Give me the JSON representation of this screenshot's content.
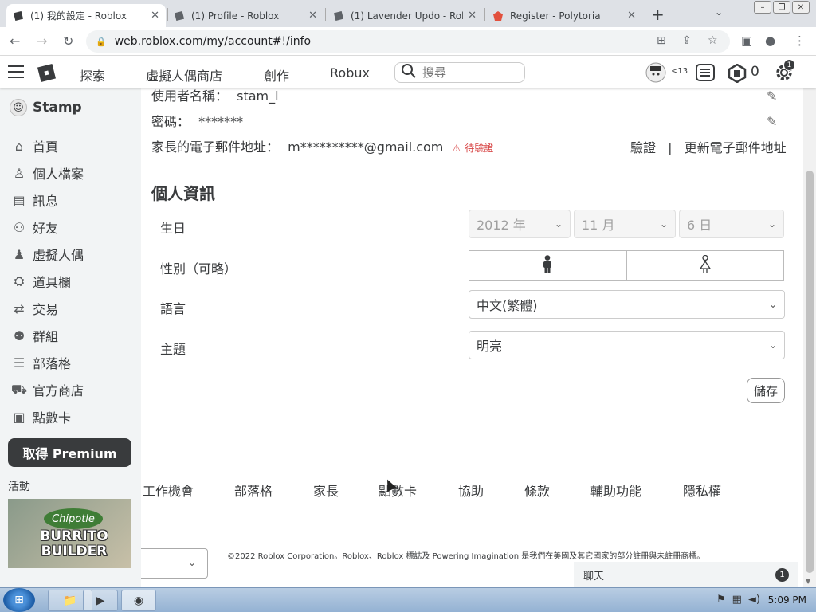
{
  "browser": {
    "tabs": [
      {
        "title": "(1) 我的設定 - Roblox",
        "active": true
      },
      {
        "title": "(1) Profile - Roblox",
        "active": false
      },
      {
        "title": "(1) Lavender Updo - Robl",
        "active": false
      },
      {
        "title": "Register - Polytoria",
        "active": false
      }
    ],
    "url": "web.roblox.com/my/account#!/info"
  },
  "topnav": {
    "items": [
      "探索",
      "虛擬人偶商店",
      "創作",
      "Robux"
    ],
    "search_placeholder": "搜尋",
    "age_label": "<13",
    "robux_count": "0",
    "notif_count": "1"
  },
  "sidebar": {
    "username": "Stamp",
    "items": [
      "首頁",
      "個人檔案",
      "訊息",
      "好友",
      "虛擬人偶",
      "道具欄",
      "交易",
      "群組",
      "部落格",
      "官方商店",
      "點數卡"
    ],
    "premium_label": "取得 Premium",
    "events_label": "活動",
    "event_badge": "Chipotle",
    "event_title": "BURRITO BUILDER"
  },
  "account": {
    "username_label": "使用者名稱：",
    "username_value": "stam_l",
    "password_label": "密碼：",
    "password_value": "*******",
    "email_label": "家長的電子郵件地址：",
    "email_value": "m**********@gmail.com",
    "email_status": "待驗證",
    "verify_link": "驗證",
    "separator": "|",
    "update_email_link": "更新電子郵件地址"
  },
  "personal": {
    "heading": "個人資訊",
    "birthday_label": "生日",
    "birthday_year": "2012 年",
    "birthday_month": "11 月",
    "birthday_day": "6 日",
    "gender_label": "性別（可略）",
    "language_label": "語言",
    "language_value": "中文(繁體)",
    "theme_label": "主題",
    "theme_value": "明亮",
    "save_label": "儲存"
  },
  "footer": {
    "links": [
      "工作機會",
      "部落格",
      "家長",
      "點數卡",
      "協助",
      "條款",
      "輔助功能",
      "隱私權"
    ],
    "copyright": "©2022 Roblox Corporation。Roblox、Roblox 標誌及 Powering Imagination 是我們在美國及其它國家的部分註冊與未註冊商標。"
  },
  "chat": {
    "label": "聊天",
    "count": "1"
  },
  "taskbar": {
    "time": "5:09 PM"
  },
  "colors": {
    "sidebar_bg": "#f2f4f5",
    "text": "#393b3d",
    "warning": "#d63f3f",
    "premium_bg": "#393b3d"
  }
}
